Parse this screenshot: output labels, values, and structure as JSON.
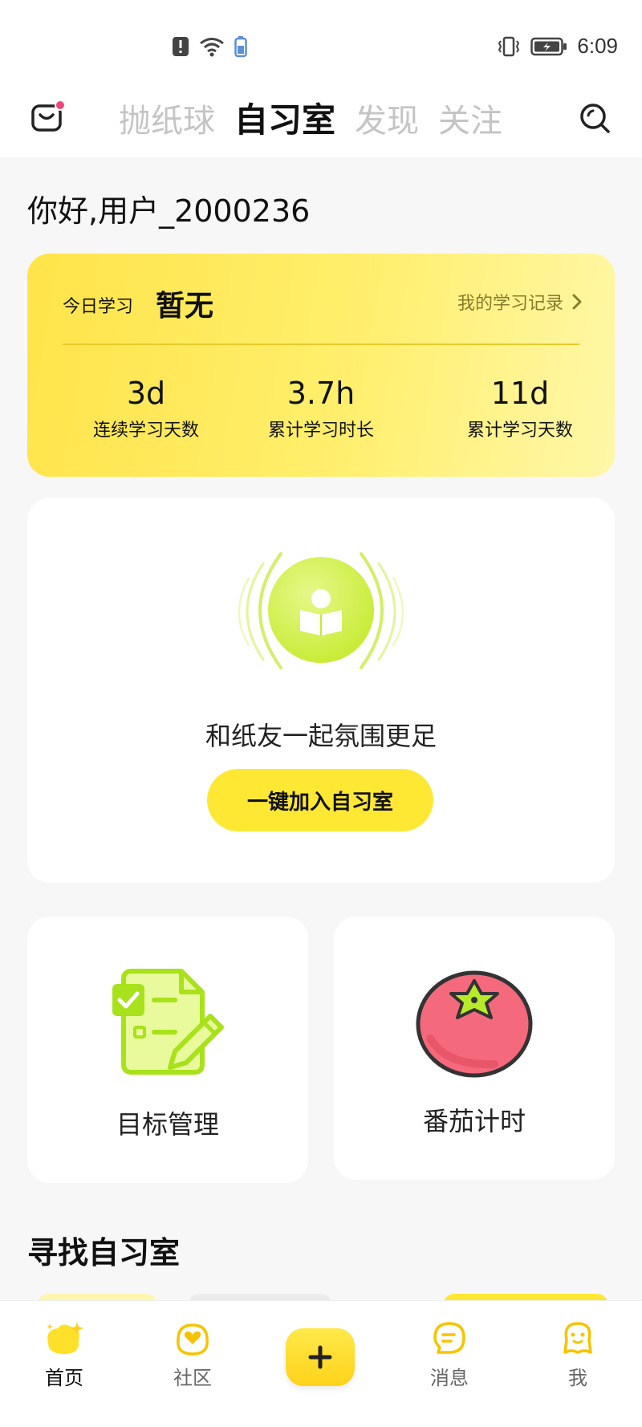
{
  "status_bar": {
    "time": "6:09"
  },
  "header": {
    "tabs": [
      {
        "label": "抛纸球",
        "active": false
      },
      {
        "label": "自习室",
        "active": true
      },
      {
        "label": "发现",
        "active": false
      },
      {
        "label": "关注",
        "active": false
      }
    ]
  },
  "greeting": "你好,用户_2000236",
  "stats": {
    "today_label": "今日学习",
    "today_value": "暂无",
    "record_link": "我的学习记录",
    "items": [
      {
        "value": "3d",
        "label": "连续学习天数"
      },
      {
        "value": "3.7h",
        "label": "累计学习时长"
      },
      {
        "value": "11d",
        "label": "累计学习天数"
      }
    ]
  },
  "join": {
    "text": "和纸友一起氛围更足",
    "button_label": "一键加入自习室"
  },
  "features": {
    "goal_label": "目标管理",
    "tomato_label": "番茄计时"
  },
  "find_title": "寻找自习室",
  "bottom_nav": {
    "home": "首页",
    "community": "社区",
    "messages": "消息",
    "me": "我"
  },
  "colors": {
    "accent_yellow": "#ffe834",
    "badge_pink": "#f0467a",
    "lime": "#c6ec2a",
    "tomato_red": "#f4697b"
  }
}
